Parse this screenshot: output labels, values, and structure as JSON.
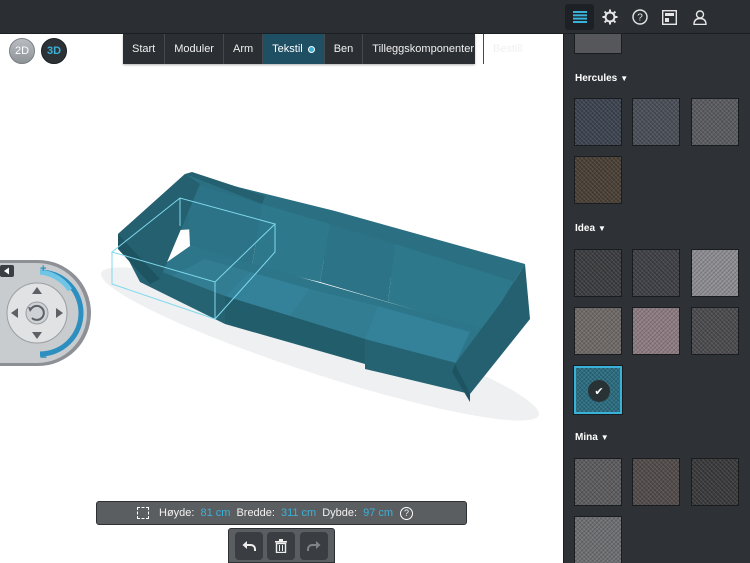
{
  "header": {
    "icons": [
      "list-icon",
      "gear-icon",
      "help-icon",
      "catalog-icon",
      "user-icon"
    ],
    "active_icon": "list-icon"
  },
  "view_modes": {
    "mode_2d": "2D",
    "mode_3d": "3D",
    "active": "3D"
  },
  "steps": [
    {
      "label": "Start"
    },
    {
      "label": "Moduler"
    },
    {
      "label": "Arm"
    },
    {
      "label": "Tekstil",
      "active": true
    },
    {
      "label": "Ben"
    },
    {
      "label": "Tilleggskomponenter"
    },
    {
      "label": "Bestill"
    }
  ],
  "dimensions": {
    "height_label": "Høyde:",
    "height_value": "81 cm",
    "width_label": "Bredde:",
    "width_value": "311 cm",
    "depth_label": "Dybde:",
    "depth_value": "97 cm",
    "help": "?"
  },
  "actions": {
    "undo": "undo-icon",
    "delete": "trash-icon",
    "redo": "redo-icon"
  },
  "fabric_groups": [
    {
      "name": "Hercules",
      "swatch_colors": [
        "#3d4450",
        "#4a4f58",
        "#5a5c60",
        "#4a4136"
      ]
    },
    {
      "name": "Idea",
      "swatch_colors": [
        "#3c3d40",
        "#3f4146",
        "#8e8d92",
        "#6f6a67",
        "#8d7c81",
        "#4c4c4f",
        "#2b6c80"
      ],
      "selected_index": 6
    },
    {
      "name": "Mina",
      "swatch_colors": [
        "#5d5d60",
        "#524c4b",
        "#3a3a3c",
        "#6e6f72"
      ]
    }
  ],
  "colors": {
    "accent": "#3ab1d8",
    "sofa": "#2a6f82",
    "panel_bg": "#2e3236"
  }
}
